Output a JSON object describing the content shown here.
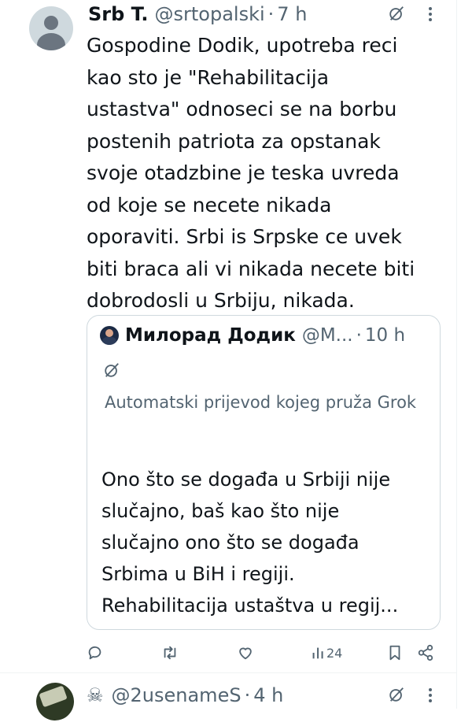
{
  "tweet": {
    "name": "Srb T.",
    "handle": "@srtopalski",
    "dot": "·",
    "time": "7 h",
    "lines": [
      "Gospodine Dodik, upotreba reci",
      "kao sto je \"Rehabilitacija",
      "ustastva\" odnoseci se na borbu",
      "postenih patriota za opstanak",
      "svoje otadzbine je teska uvreda",
      "od koje se necete nikada",
      "oporaviti. Srbi is Srpske ce uvek",
      "biti braca ali vi nikada necete biti",
      "dobrodosli u Srbiju, nikada."
    ]
  },
  "quote": {
    "name": "Милорад Додик",
    "handle": "@M...",
    "dot": "·",
    "time": "10 h",
    "translation_note": "Automatski prijevod kojeg pruža Grok",
    "lines": [
      "Ono što se događa u Srbiji nije",
      "slučajno, baš kao što nije",
      "slučajno ono što se događa",
      "Srbima u BiH i regiji.",
      "Rehabilitacija ustaštva u regij..."
    ]
  },
  "actions": {
    "views": "24"
  },
  "tweet2": {
    "handle": "@2usenameS",
    "dot": "·",
    "time": "4 h",
    "skull": "☠"
  },
  "colors": {
    "text": "#0f1419",
    "muted": "#536471",
    "border": "#cfd9de"
  },
  "icons": [
    "grok-icon",
    "more-icon",
    "reply-icon",
    "retweet-icon",
    "like-icon",
    "views-icon",
    "bookmark-icon",
    "share-icon"
  ]
}
